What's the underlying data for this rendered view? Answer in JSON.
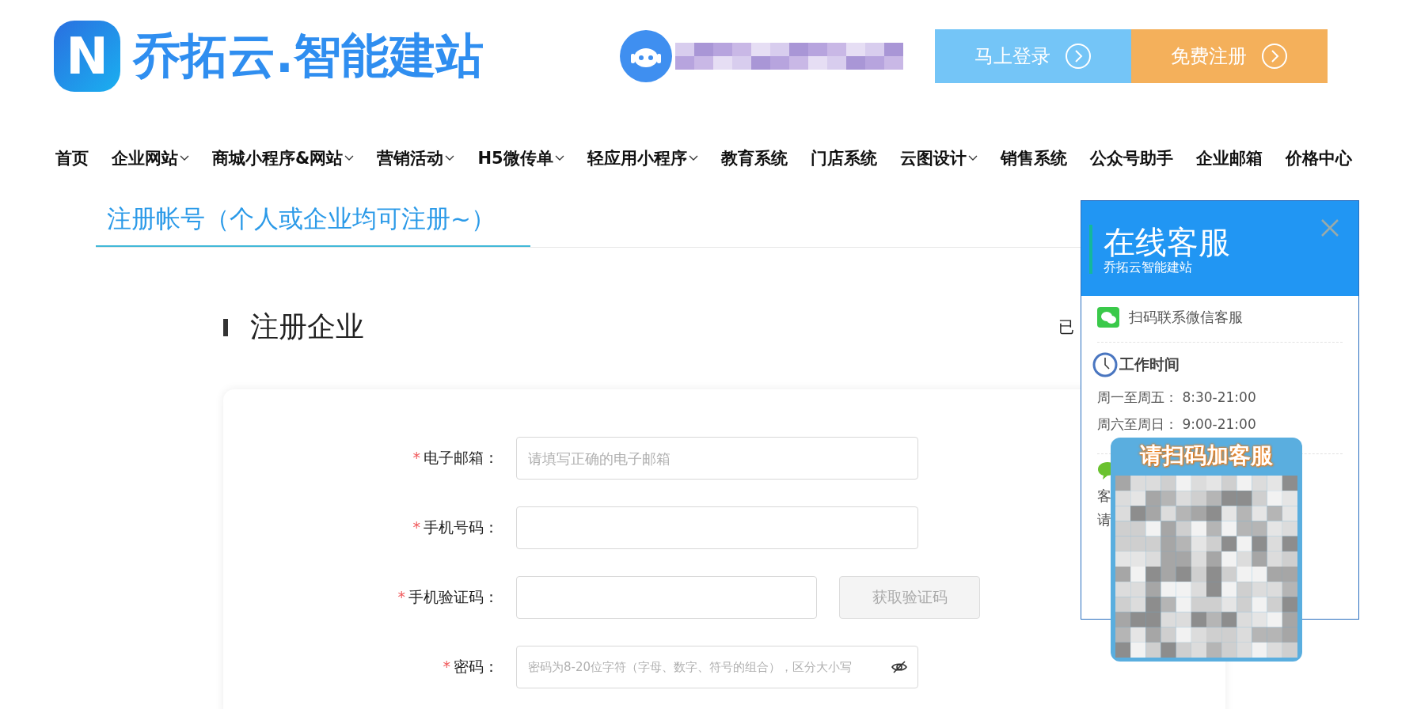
{
  "header": {
    "logo_letter": "N",
    "logo_text": "乔拓云.智能建站",
    "buttons": [
      {
        "label": "马上登录",
        "kind": "login"
      },
      {
        "label": "免费注册",
        "kind": "register"
      }
    ]
  },
  "nav": [
    {
      "label": "首页",
      "dropdown": false
    },
    {
      "label": "企业网站",
      "dropdown": true
    },
    {
      "label": "商城小程序&网站",
      "dropdown": true
    },
    {
      "label": "营销活动",
      "dropdown": true
    },
    {
      "label": "H5微传单",
      "dropdown": true
    },
    {
      "label": "轻应用小程序",
      "dropdown": true
    },
    {
      "label": "教育系统",
      "dropdown": false
    },
    {
      "label": "门店系统",
      "dropdown": false
    },
    {
      "label": "云图设计",
      "dropdown": true
    },
    {
      "label": "销售系统",
      "dropdown": false
    },
    {
      "label": "公众号助手",
      "dropdown": false
    },
    {
      "label": "企业邮箱",
      "dropdown": false
    },
    {
      "label": "价格中心",
      "dropdown": false
    }
  ],
  "page_tab": {
    "label": "注册帐号（个人或企业均可注册~）",
    "selected": true
  },
  "section": {
    "title": "注册企业",
    "right_text": "已"
  },
  "form": {
    "fields": [
      {
        "label": "电子邮箱：",
        "required_mark": "*",
        "placeholder": "请填写正确的电子邮箱",
        "kind": "text"
      },
      {
        "label": "手机号码：",
        "required_mark": "*",
        "kind": "text"
      },
      {
        "label": "手机验证码：",
        "required_mark": "*",
        "kind": "code",
        "button": "获取验证码"
      },
      {
        "label": "密码：",
        "required_mark": "*",
        "placeholder": "密码为8-20位字符（字母、数字、符号的组合），区分大小写",
        "kind": "password"
      }
    ]
  },
  "service_panel": {
    "title": "在线客服",
    "subtitle": "乔拓云智能建站",
    "wechat_label": "扫码联系微信客服",
    "hours_title": "工作时间",
    "hours": [
      "周一至周五： 8:30-21:00",
      "周六至周日： 9:00-21:00"
    ],
    "cut_lines": [
      "客",
      "请"
    ],
    "qr_title": "请扫码加客服"
  }
}
